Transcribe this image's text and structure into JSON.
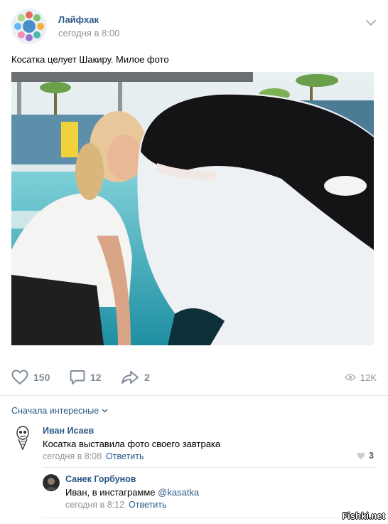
{
  "post": {
    "group_name": "Лайфхак",
    "time": "сегодня в 8:00",
    "text": "Косатка целует Шакиру. Милое фото",
    "photo_icon": "photo-orca-kiss"
  },
  "actions": {
    "likes": "150",
    "comments": "12",
    "shares": "2",
    "views": "12K"
  },
  "comments_section": {
    "sort_label": "Сначала интересные"
  },
  "comments": [
    {
      "author": "Иван Исаев",
      "text": "Косатка выставила фото своего завтрака",
      "time": "сегодня в 8:08",
      "reply_label": "Ответить",
      "likes": "3"
    },
    {
      "author": "Санек Горбунов",
      "text_prefix": "Иван, в инстаграмме ",
      "mention": "@kasatka",
      "time": "сегодня в 8:12",
      "reply_label": "Ответить"
    }
  ],
  "watermark": "Fishki.net",
  "colors": {
    "link": "#2a5885",
    "muted": "#939393",
    "icon": "#818c99",
    "divider": "#e7e8ec"
  }
}
